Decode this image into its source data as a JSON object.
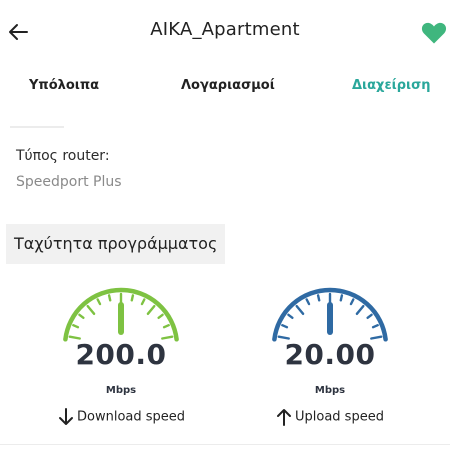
{
  "header": {
    "title": "AIKA_Apartment",
    "favorite_color": "#3fb67e"
  },
  "tabs": [
    {
      "label": "Υπόλοιπα"
    },
    {
      "label": "Λογαριασμοί"
    },
    {
      "label": "Διαχείριση"
    }
  ],
  "active_tab": "Διαχείριση",
  "router": {
    "label": "Τύπος router:",
    "value": "Speedport Plus"
  },
  "section": {
    "title": "Ταχύτητα προγράμματος"
  },
  "gauges": {
    "download": {
      "value": "200.0",
      "unit": "Mbps",
      "label": "Download speed",
      "color": "#7ec242"
    },
    "upload": {
      "value": "20.00",
      "unit": "Mbps",
      "label": "Upload speed",
      "color": "#2f6aa3"
    }
  }
}
